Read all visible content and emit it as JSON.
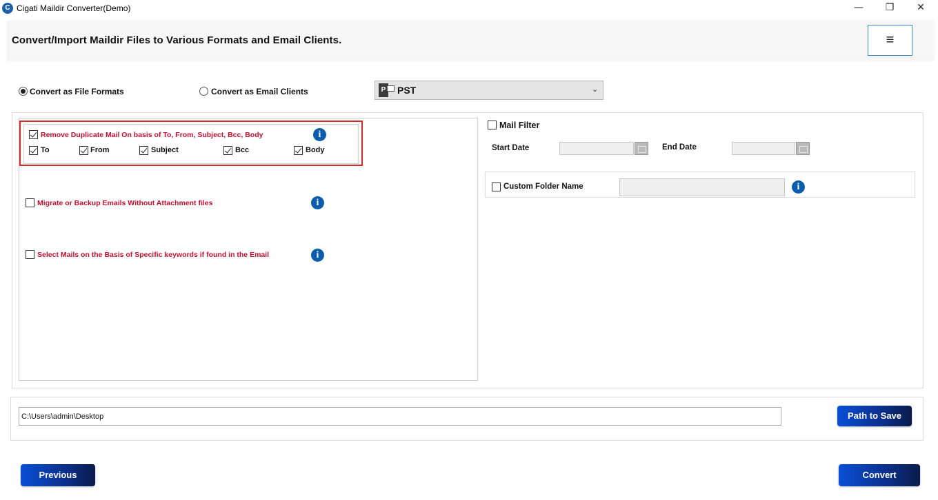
{
  "window": {
    "title": "Cigati Maildir Converter(Demo)",
    "app_icon_glyph": "C",
    "minimize_glyph": "—",
    "maximize_glyph": "❐",
    "close_glyph": "✕"
  },
  "header": {
    "text": "Convert/Import Maildir Files to Various Formats and Email Clients.",
    "menu_glyph": "≡"
  },
  "mode": {
    "file_formats_label": "Convert as File Formats",
    "file_formats_selected": true,
    "email_clients_label": "Convert as Email Clients",
    "email_clients_selected": false
  },
  "format_select": {
    "value": "PST",
    "icon_letter": "P",
    "chevron": "⌄"
  },
  "left_options": {
    "duplicate": {
      "label": "Remove Duplicate Mail On basis of To, From, Subject, Bcc, Body",
      "checked": true,
      "fields": [
        {
          "label": "To",
          "checked": true
        },
        {
          "label": "From",
          "checked": true
        },
        {
          "label": "Subject",
          "checked": true
        },
        {
          "label": "Bcc",
          "checked": true
        },
        {
          "label": "Body",
          "checked": true
        }
      ]
    },
    "no_attachments": {
      "label": "Migrate or Backup Emails Without Attachment files",
      "checked": false
    },
    "keywords": {
      "label": "Select Mails on the Basis of Specific keywords if found in the Email",
      "checked": false
    },
    "info_glyph": "i"
  },
  "mail_filter": {
    "label": "Mail Filter",
    "checked": false,
    "start_label": "Start Date",
    "start_value": "",
    "end_label": "End Date",
    "end_value": ""
  },
  "custom_folder": {
    "label": "Custom Folder Name",
    "checked": false,
    "value": ""
  },
  "save": {
    "path": "C:\\Users\\admin\\Desktop",
    "button_label": "Path to Save"
  },
  "footer": {
    "previous_label": "Previous",
    "convert_label": "Convert"
  },
  "colors": {
    "accent_blue": "#0b5cad",
    "highlight_red": "#d32a2a",
    "label_red": "#c8102e"
  }
}
